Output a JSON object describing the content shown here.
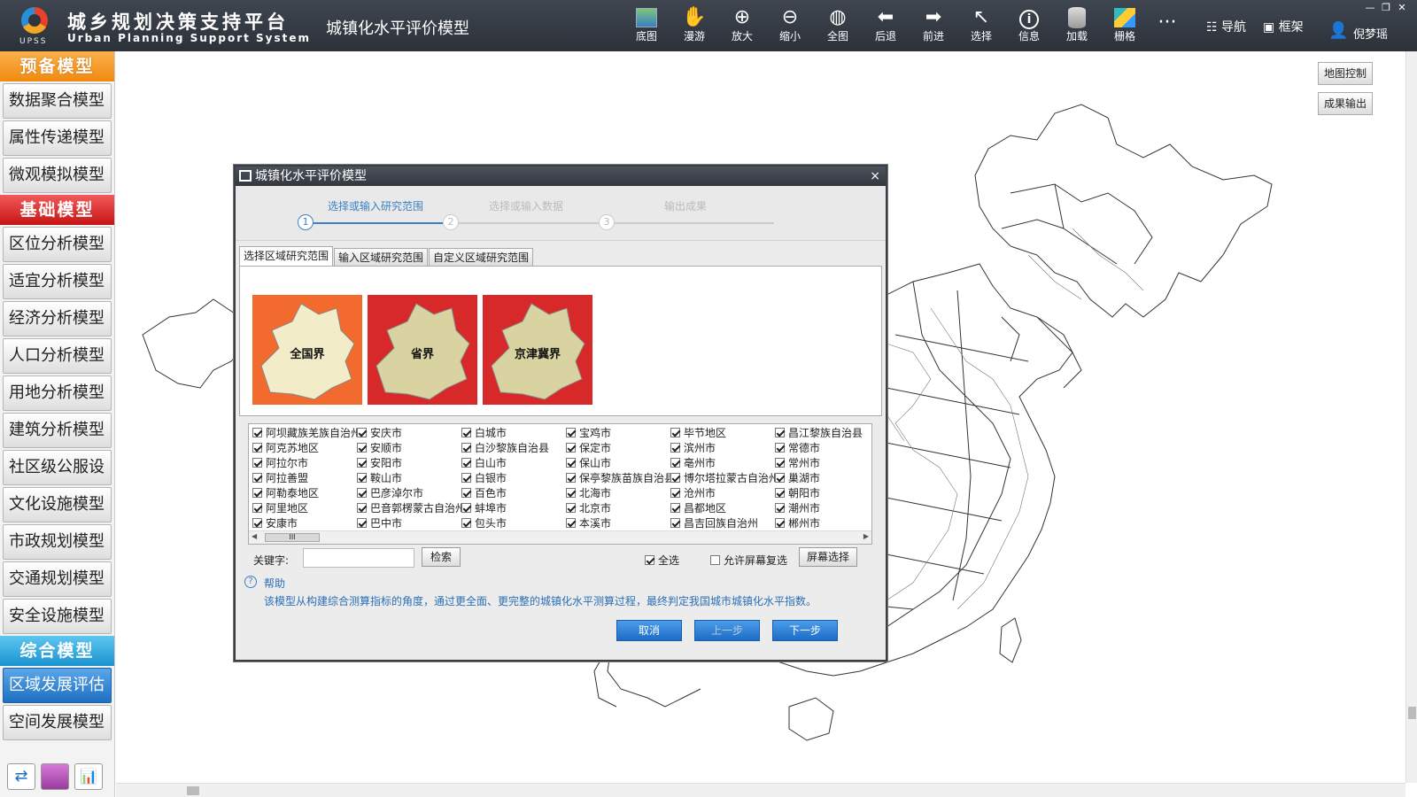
{
  "app": {
    "logo_abbr": "UPSS",
    "title_cn": "城乡规划决策支持平台",
    "title_en": "Urban Planning Support System",
    "module_title": "城镇化水平评价模型"
  },
  "toolbar": [
    {
      "label": "底图",
      "icon": "basemap-icon"
    },
    {
      "label": "漫游",
      "icon": "hand-icon",
      "glyph": "✋"
    },
    {
      "label": "放大",
      "icon": "zoom-in-icon",
      "glyph": "⊕"
    },
    {
      "label": "缩小",
      "icon": "zoom-out-icon",
      "glyph": "⊖"
    },
    {
      "label": "全图",
      "icon": "globe-icon",
      "glyph": "◍"
    },
    {
      "label": "后退",
      "icon": "arrow-left-icon",
      "glyph": "⬅"
    },
    {
      "label": "前进",
      "icon": "arrow-right-icon",
      "glyph": "➡"
    },
    {
      "label": "选择",
      "icon": "cursor-icon",
      "glyph": "↖"
    },
    {
      "label": "信息",
      "icon": "info-icon",
      "glyph": "i"
    },
    {
      "label": "加载",
      "icon": "database-icon"
    },
    {
      "label": "栅格",
      "icon": "raster-icon"
    }
  ],
  "more_glyph": "···",
  "top_right": {
    "nav": "导航",
    "frame": "框架",
    "user": "倪梦瑶"
  },
  "window_controls": [
    "—",
    "❐",
    "✕"
  ],
  "sidebar": {
    "sections": [
      {
        "title": "预备模型",
        "style": "orange",
        "items": [
          "数据聚合模型",
          "属性传递模型",
          "微观模拟模型"
        ]
      },
      {
        "title": "基础模型",
        "style": "red",
        "items": [
          "区位分析模型",
          "适宜分析模型",
          "经济分析模型",
          "人口分析模型",
          "用地分析模型",
          "建筑分析模型",
          "社区级公服设",
          "文化设施模型",
          "市政规划模型",
          "交通规划模型",
          "安全设施模型"
        ]
      },
      {
        "title": "综合模型",
        "style": "blue",
        "items": [
          "区域发展评估",
          "空间发展模型"
        ],
        "active": "区域发展评估"
      }
    ]
  },
  "map_buttons": {
    "control": "地图控制",
    "output": "成果输出"
  },
  "dialog": {
    "title": "城镇化水平评价模型",
    "close": "×",
    "steps": [
      {
        "num": "1",
        "label": "选择或输入研究范围",
        "active": true
      },
      {
        "num": "2",
        "label": "选择或输入数据",
        "active": false
      },
      {
        "num": "3",
        "label": "输出成果",
        "active": false
      }
    ],
    "tabs": [
      "选择区域研究范围",
      "输入区域研究范围",
      "自定义区域研究范围"
    ],
    "region_cards": [
      {
        "label": "全国界",
        "bg": "#f26a2e",
        "shape": "#f3ecc8"
      },
      {
        "label": "省界",
        "bg": "#d7282a",
        "shape": "#d8d3a0"
      },
      {
        "label": "京津冀界",
        "bg": "#d7282a",
        "shape": "#d8d3a0"
      }
    ],
    "cities": [
      [
        "阿坝藏族羌族自治州",
        "阿克苏地区",
        "阿拉尔市",
        "阿拉善盟",
        "阿勒泰地区",
        "阿里地区",
        "安康市"
      ],
      [
        "安庆市",
        "安顺市",
        "安阳市",
        "鞍山市",
        "巴彦淖尔市",
        "巴音郭楞蒙古自治州",
        "巴中市"
      ],
      [
        "白城市",
        "白沙黎族自治县",
        "白山市",
        "白银市",
        "百色市",
        "蚌埠市",
        "包头市"
      ],
      [
        "宝鸡市",
        "保定市",
        "保山市",
        "保亭黎族苗族自治县",
        "北海市",
        "北京市",
        "本溪市"
      ],
      [
        "毕节地区",
        "滨州市",
        "亳州市",
        "博尔塔拉蒙古自治州",
        "沧州市",
        "昌都地区",
        "昌吉回族自治州"
      ],
      [
        "昌江黎族自治县",
        "常德市",
        "常州市",
        "巢湖市",
        "朝阳市",
        "潮州市",
        "郴州市"
      ]
    ],
    "list_scroll_thumb": "III",
    "keyword_label": "关键字:",
    "keyword_value": "",
    "search_button": "检索",
    "select_all": "全选",
    "allow_multi": "允许屏幕复选",
    "screen_select": "屏幕选择",
    "help_label": "帮助",
    "help_text": "该模型从构建综合测算指标的角度，通过更全面、更完整的城镇化水平测算过程，最终判定我国城市城镇化水平指数。",
    "buttons": {
      "cancel": "取消",
      "prev": "上一步",
      "next": "下一步"
    }
  }
}
